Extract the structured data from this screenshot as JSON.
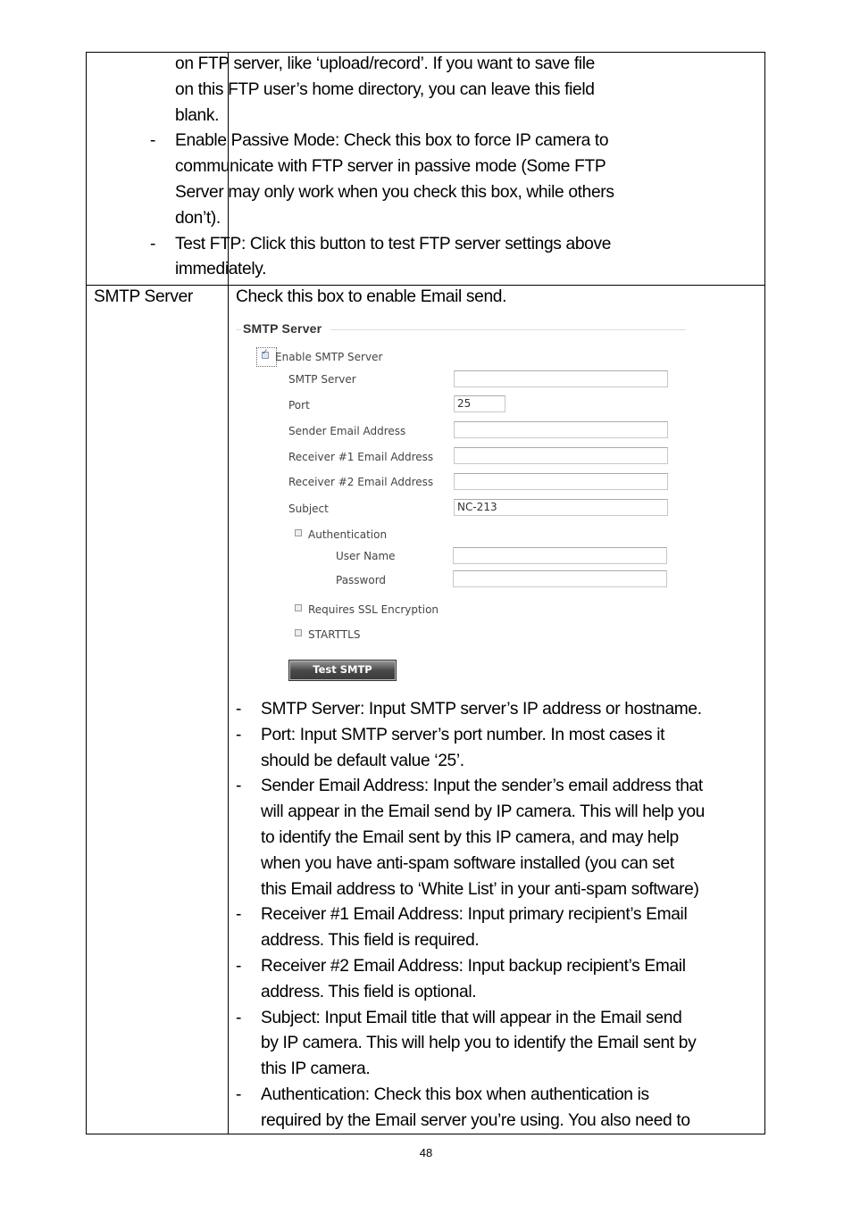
{
  "top_row": {
    "continuation_lines": [
      "on FTP server, like ‘upload/record’. If you want to save file",
      "on this FTP user’s home directory, you can leave this field",
      "blank."
    ],
    "bullets": [
      {
        "dash": "-",
        "lines": [
          "Enable Passive Mode: Check this box to force IP camera to",
          "communicate with FTP server in passive mode (Some FTP",
          "Server may only work when you check this box, while others",
          "don’t)."
        ]
      },
      {
        "dash": "-",
        "lines": [
          "Test FTP: Click this button to test FTP server settings above",
          "immediately."
        ]
      }
    ]
  },
  "smtp_row": {
    "label": "SMTP Server",
    "intro": "Check this box to enable Email send.",
    "form": {
      "legend": "SMTP Server",
      "enable": {
        "label": "Enable SMTP Server",
        "checked": true
      },
      "fields": [
        {
          "label": "SMTP Server",
          "value": ""
        },
        {
          "label": "Port",
          "value": "25"
        },
        {
          "label": "Sender Email Address",
          "value": ""
        },
        {
          "label": "Receiver #1 Email Address",
          "value": ""
        },
        {
          "label": "Receiver #2 Email Address",
          "value": ""
        },
        {
          "label": "Subject",
          "value": "NC-213"
        }
      ],
      "authentication": {
        "label": "Authentication",
        "checked": false
      },
      "auth_fields": [
        {
          "label": "User Name",
          "value": ""
        },
        {
          "label": "Password",
          "value": ""
        }
      ],
      "ssl": {
        "label": "Requires SSL Encryption",
        "checked": false
      },
      "starttls": {
        "label": "STARTTLS",
        "checked": false
      },
      "test_button": "Test SMTP"
    },
    "bullets": [
      {
        "dash": "-",
        "lines": [
          "SMTP Server: Input SMTP server’s IP address or hostname."
        ]
      },
      {
        "dash": "-",
        "lines": [
          "Port: Input SMTP server’s port number. In most cases it",
          "should be default value ‘25’."
        ]
      },
      {
        "dash": "-",
        "lines": [
          "Sender Email Address: Input the sender’s email address that",
          "will appear in the Email send by IP camera. This will help you",
          "to identify the Email sent by this IP camera, and may help",
          "when you have anti-spam software installed (you can set",
          "this Email address to ‘White List’ in your anti-spam software)"
        ]
      },
      {
        "dash": "-",
        "lines": [
          "Receiver #1 Email Address: Input primary recipient’s Email",
          "address. This field is required."
        ]
      },
      {
        "dash": "-",
        "lines": [
          "Receiver #2 Email Address: Input backup recipient’s Email",
          "address. This field is optional."
        ]
      },
      {
        "dash": "-",
        "lines": [
          "Subject: Input Email title that will appear in the Email send",
          "by IP camera. This will help you to identify the Email sent by",
          "this IP camera."
        ]
      },
      {
        "dash": "-",
        "lines": [
          "Authentication: Check this box when authentication is",
          "required by the Email server you’re using. You also need to"
        ]
      }
    ]
  },
  "page_number": "48"
}
